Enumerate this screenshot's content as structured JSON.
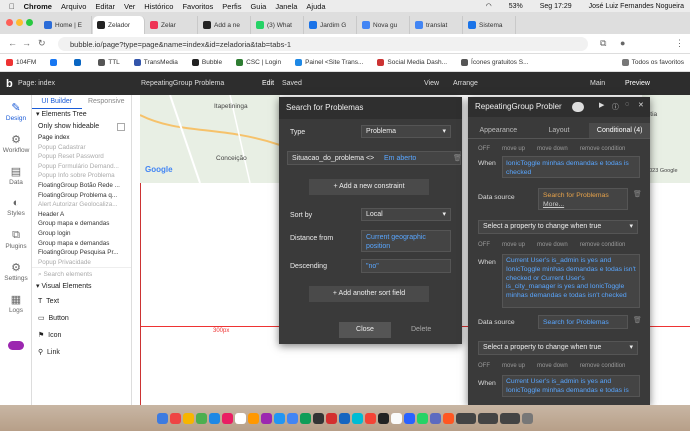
{
  "menubar": {
    "app": "Chrome",
    "items": [
      "Arquivo",
      "Editar",
      "Ver",
      "Histórico",
      "Favoritos",
      "Perfis",
      "Guia",
      "Janela",
      "Ajuda"
    ],
    "battery": "53%",
    "time": "Seg 17:29",
    "user": "José Luiz Fernandes Nogueira"
  },
  "tabs": [
    {
      "label": "Home | E",
      "color": "#2b6cd8"
    },
    {
      "label": "Zelador",
      "color": "#222"
    },
    {
      "label": "Zelar",
      "color": "#e35"
    },
    {
      "label": "Add a ne",
      "color": "#222"
    },
    {
      "label": "(3) What",
      "color": "#25d366"
    },
    {
      "label": "Jardim G",
      "color": "#1a73e8"
    },
    {
      "label": "Nova gu",
      "color": "#4285f4"
    },
    {
      "label": "translat",
      "color": "#4285f4"
    },
    {
      "label": "Sistema",
      "color": "#1a73e8"
    }
  ],
  "address": {
    "url": "bubble.io/page?type=page&name=index&id=zeladoria&tab=tabs-1"
  },
  "bookmarks": [
    {
      "label": "104FM",
      "color": "#e33"
    },
    {
      "label": "",
      "color": "#1877f2"
    },
    {
      "label": "",
      "color": "#0a66c2"
    },
    {
      "label": "TTL",
      "color": "#555"
    },
    {
      "label": "TransMedia",
      "color": "#3355aa"
    },
    {
      "label": "Bubble",
      "color": "#222"
    },
    {
      "label": "CSC | Login",
      "color": "#2e7d32"
    },
    {
      "label": "Painel <Site Trans...",
      "color": "#1e88e5"
    },
    {
      "label": "Social Media Dash...",
      "color": "#c33"
    },
    {
      "label": "Ícones gratuitos S...",
      "color": "#555"
    },
    {
      "label": "Todos os favoritos",
      "color": "#777"
    }
  ],
  "bubble": {
    "page": "Page: index",
    "element": "RepeatingGroup Problema",
    "edit": "Edit",
    "saved": "Saved",
    "view": "View",
    "arrange": "Arrange",
    "main": "Main",
    "preview": "Preview"
  },
  "rail": [
    {
      "label": "Design",
      "icon": "✎"
    },
    {
      "label": "Workflow",
      "icon": "⚙"
    },
    {
      "label": "Data",
      "icon": "▤"
    },
    {
      "label": "Styles",
      "icon": "◐"
    },
    {
      "label": "Plugins",
      "icon": "⧉"
    },
    {
      "label": "Settings",
      "icon": "⚙"
    },
    {
      "label": "Logs",
      "icon": "▦"
    }
  ],
  "elements": {
    "tab_builder": "UI Builder",
    "tab_responsive": "Responsive",
    "tree_title": "Elements Tree",
    "only_hideable": "Only show hideable",
    "search_placeholder": "Search elements",
    "visual_title": "Visual Elements",
    "tree": [
      {
        "t": "Page index",
        "d": false
      },
      {
        "t": "Popup Cadastrar",
        "d": true
      },
      {
        "t": "Popup Reset Password",
        "d": true
      },
      {
        "t": "Popup Formulário Demand...",
        "d": true
      },
      {
        "t": "Popup Info sobre Problema",
        "d": true
      },
      {
        "t": "FloatingGroup Botão Rede ...",
        "d": false
      },
      {
        "t": "FloatingGroup Problema q...",
        "d": false
      },
      {
        "t": "Alert Autorizar Geolocaliza...",
        "d": true
      },
      {
        "t": "Header A",
        "d": false
      },
      {
        "t": "Group mapa e demandas",
        "d": false
      },
      {
        "t": "Group login",
        "d": false
      },
      {
        "t": "Group mapa e demandas",
        "d": false
      },
      {
        "t": "FloatingGroup Pesquisa Pr...",
        "d": false
      },
      {
        "t": "Popup Privacidade",
        "d": true
      }
    ],
    "visual": [
      "Text",
      "Button",
      "Icon",
      "Link"
    ]
  },
  "map": {
    "labels": [
      "Itapetininga",
      "Conceição",
      "Google",
      "Cotia",
      "©2023 Google"
    ],
    "width_label": "300px"
  },
  "search": {
    "title": "Search for Problemas",
    "type_label": "Type",
    "type_value": "Problema",
    "constraint_field": "Situacao_do_problema <>",
    "constraint_value": "Em aberto",
    "add_constraint": "Add a new constraint",
    "sort_label": "Sort by",
    "sort_value": "Local",
    "distance_label": "Distance from",
    "distance_value": "Current geographic position",
    "descending_label": "Descending",
    "descending_value": "\"no\"",
    "add_sort": "Add another sort field",
    "close": "Close",
    "delete": "Delete"
  },
  "cond": {
    "title": "RepeatingGroup Probler",
    "tabs": [
      "Appearance",
      "Layout",
      "Conditional (4)"
    ],
    "controls": [
      "OFF",
      "move up",
      "move down",
      "remove condition"
    ],
    "when": "When",
    "when1": "IonicToggle minhas demandas e todas is checked",
    "datasource_label": "Data source",
    "ds1": "Search for Problemas",
    "ds1_more": "More...",
    "select_prop": "Select a property to change when true",
    "when2": "Current User's is_admin is yes and IonicToggle minhas demandas e todas isn't checked or Current User's is_city_manager is yes and IonicToggle minhas demandas e todas isn't checked",
    "ds2": "Search for Problemas",
    "when3": "Current User's is_admin is yes and IonicToggle minhas demandas e todas is"
  }
}
